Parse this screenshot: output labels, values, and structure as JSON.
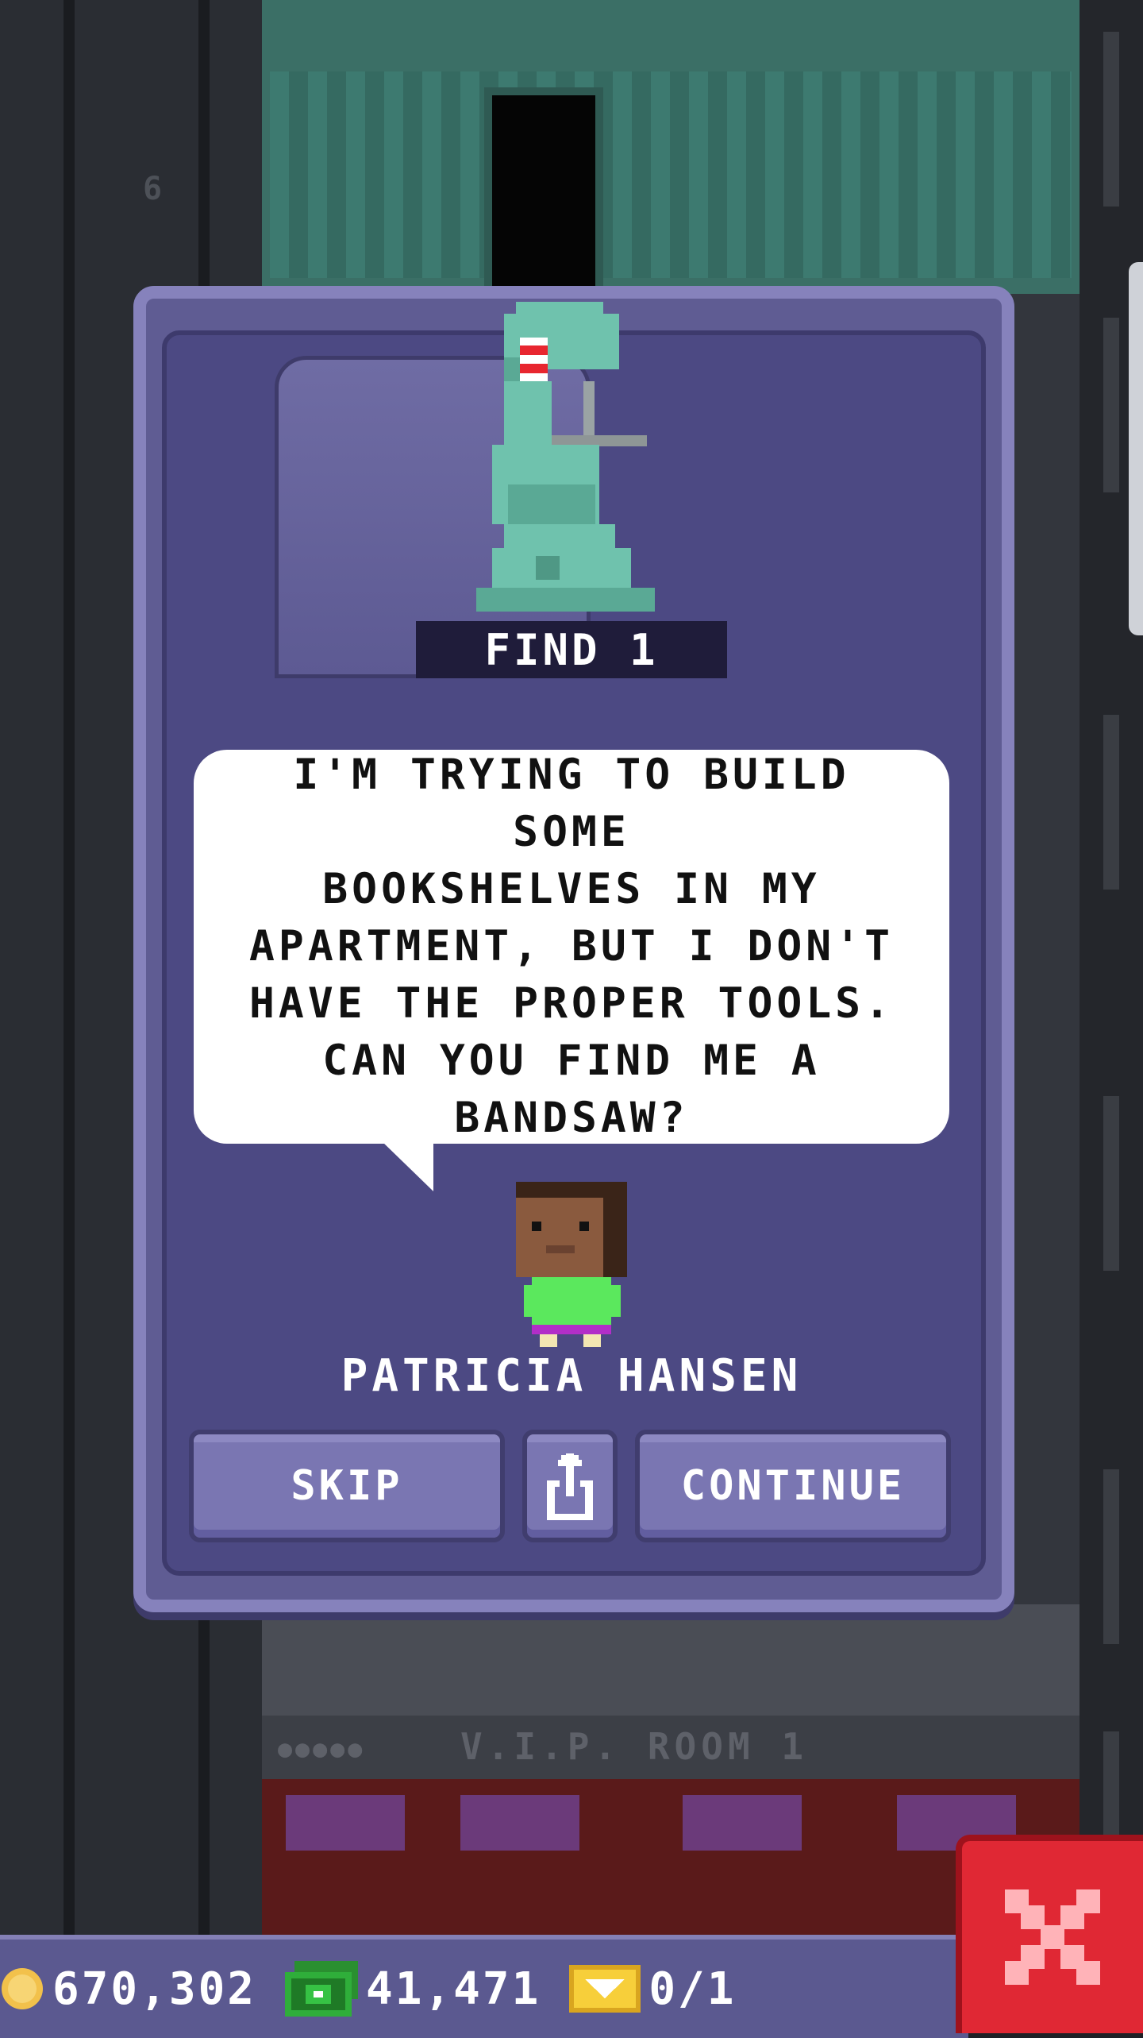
{
  "background": {
    "floor_number": "6",
    "vip_floor_label": "V.I.P. ROOM 1"
  },
  "quest": {
    "item_icon": "bandsaw-icon",
    "objective": "FIND 1",
    "message": "I'M TRYING TO BUILD SOME\nBOOKSHELVES IN MY\nAPARTMENT, BUT I DON'T\nHAVE THE PROPER TOOLS.\nCAN YOU FIND ME A\nBANDSAW?",
    "npc_name": "PATRICIA HANSEN",
    "buttons": {
      "skip_label": "SKIP",
      "share_icon": "share-icon",
      "continue_label": "CONTINUE"
    }
  },
  "hud": {
    "coins": "670,302",
    "bux": "41,471",
    "tickets": "0/1"
  },
  "colors": {
    "dialog": "#5f5c93",
    "dialog_border": "#8682bc",
    "button": "#7a76b2",
    "close_button": "#e02834",
    "coin": "#f2c14b",
    "bux": "#2fae3a",
    "ticket": "#f0c030"
  }
}
